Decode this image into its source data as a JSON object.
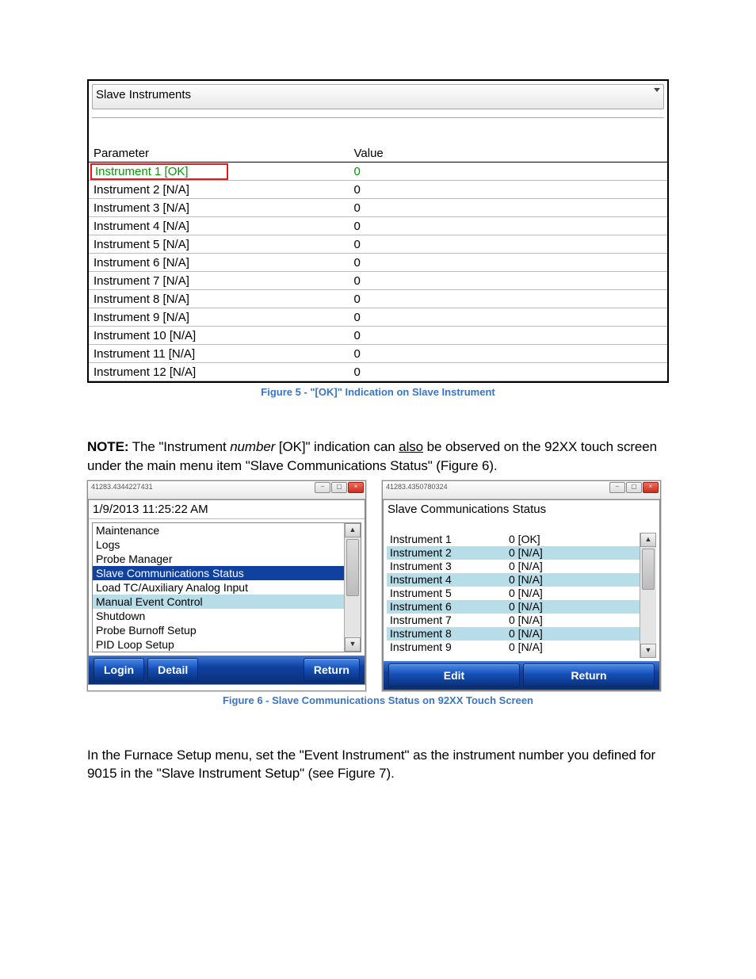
{
  "fig5": {
    "dropdown_label": "Slave Instruments",
    "columns": {
      "c1": "Parameter",
      "c2": "Value"
    },
    "rows": [
      {
        "p": "Instrument 1 [OK]",
        "v": "0",
        "ok": true
      },
      {
        "p": "Instrument 2 [N/A]",
        "v": "0"
      },
      {
        "p": "Instrument 3 [N/A]",
        "v": "0"
      },
      {
        "p": "Instrument 4 [N/A]",
        "v": "0"
      },
      {
        "p": "Instrument 5 [N/A]",
        "v": "0"
      },
      {
        "p": "Instrument 6 [N/A]",
        "v": "0"
      },
      {
        "p": "Instrument 7 [N/A]",
        "v": "0"
      },
      {
        "p": "Instrument 8 [N/A]",
        "v": "0"
      },
      {
        "p": "Instrument 9 [N/A]",
        "v": "0"
      },
      {
        "p": "Instrument 10 [N/A]",
        "v": "0"
      },
      {
        "p": "Instrument 11 [N/A]",
        "v": "0"
      },
      {
        "p": "Instrument 12 [N/A]",
        "v": "0"
      }
    ],
    "caption": "Figure 5 - \"[OK]\" Indication on Slave Instrument"
  },
  "note": {
    "lead": "NOTE:",
    "t1": " The \"Instrument ",
    "number": "number",
    "t2": " [OK]\" indication can ",
    "also": "also",
    "t3": " be observed on the 92XX touch screen under the main menu item \"Slave Communications Status\" (",
    "ref": "Figure 6",
    "t4": ")."
  },
  "fig6": {
    "left": {
      "winid": "41283.4344227431",
      "timestamp": "1/9/2013 11:25:22 AM",
      "menu": [
        {
          "label": "Maintenance"
        },
        {
          "label": "Logs"
        },
        {
          "label": "Probe Manager"
        },
        {
          "label": "Slave Communications Status",
          "sel": true
        },
        {
          "label": "Load TC/Auxiliary Analog Input"
        },
        {
          "label": "Manual Event Control",
          "hl": true
        },
        {
          "label": "Shutdown"
        },
        {
          "label": "Probe Burnoff Setup"
        },
        {
          "label": "PID Loop Setup"
        }
      ],
      "buttons": {
        "login": "Login",
        "detail": "Detail",
        "ret": "Return"
      }
    },
    "right": {
      "winid": "41283.4350780324",
      "title": "Slave Communications Status",
      "rows": [
        {
          "n": "Instrument 1",
          "v": "0 [OK]"
        },
        {
          "n": "Instrument 2",
          "v": "0 [N/A]"
        },
        {
          "n": "Instrument 3",
          "v": "0 [N/A]"
        },
        {
          "n": "Instrument 4",
          "v": "0 [N/A]"
        },
        {
          "n": "Instrument 5",
          "v": "0 [N/A]"
        },
        {
          "n": "Instrument 6",
          "v": "0 [N/A]"
        },
        {
          "n": "Instrument 7",
          "v": "0 [N/A]"
        },
        {
          "n": "Instrument 8",
          "v": "0 [N/A]"
        },
        {
          "n": "Instrument 9",
          "v": "0 [N/A]"
        }
      ],
      "buttons": {
        "edit": "Edit",
        "ret": "Return"
      }
    },
    "caption": "Figure 6 - Slave Communications Status on 92XX Touch Screen"
  },
  "para2": {
    "t1": "In the Furnace Setup menu, set the \"Event Instrument\" as the instrument number you defined for 9015 in the \"Slave Instrument Setup\" (see ",
    "ref": "Figure 7",
    "t2": ")."
  }
}
